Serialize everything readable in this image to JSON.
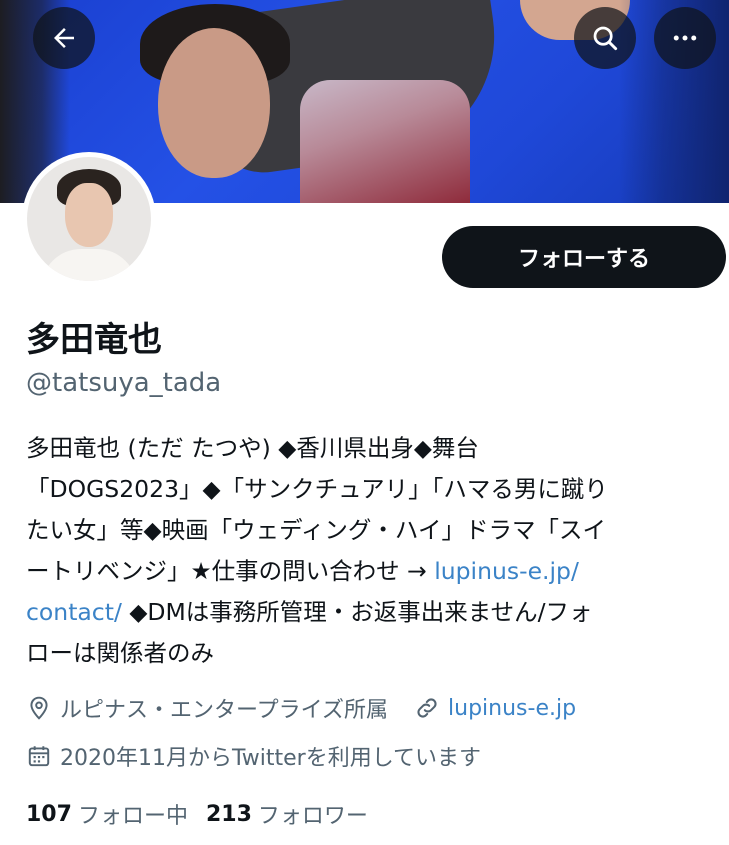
{
  "colors": {
    "banner": "#2451e6",
    "text": "#0f1419",
    "muted": "#536471",
    "link": "#3b83c7",
    "button": "#0f1419"
  },
  "header": {
    "back_icon": "arrow-left-icon",
    "search_icon": "search-icon",
    "more_icon": "more-dots-icon"
  },
  "profile": {
    "follow_label": "フォローする",
    "name": "多田竜也",
    "handle": "@tatsuya_tada",
    "bio": {
      "line1": "多田竜也 (ただ たつや) ◆香川県出身◆舞台",
      "line2": "「DOGS2023」◆「サンクチュアリ」「ハマる男に蹴り",
      "line3": "たい女」等◆映画「ウェディング・ハイ」ドラマ「スイ",
      "line4_text": "ートリベンジ」★仕事の問い合わせ → ",
      "line4_link": "lupinus-e.jp/",
      "line5_link": "contact/",
      "line5_text": " ◆DMは事務所管理・お返事出来ません/フォ",
      "line6": "ローは関係者のみ"
    },
    "location": "ルピナス・エンタープライズ所属",
    "website": "lupinus-e.jp",
    "joined": "2020年11月からTwitterを利用しています",
    "following_count": "107",
    "following_label": "フォロー中",
    "followers_count": "213",
    "followers_label": "フォロワー"
  }
}
